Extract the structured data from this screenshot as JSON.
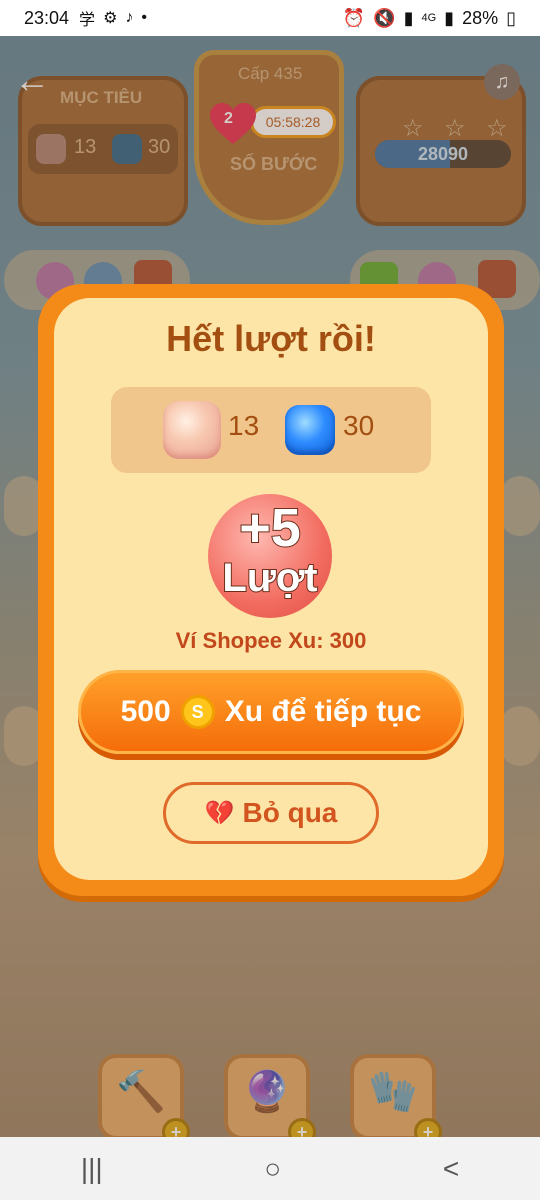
{
  "status_bar": {
    "time": "23:04",
    "left_icons": [
      "学",
      "gear-icon",
      "tiktok-icon",
      "•"
    ],
    "network": "4G",
    "battery": "28%"
  },
  "header": {
    "target_title": "MỤC TIÊU",
    "target_pink_count": "13",
    "target_blue_count": "30",
    "level_label": "Cấp 435",
    "moves_label": "SỐ BƯỚC",
    "lives_count": "2",
    "lives_timer": "05:58:28",
    "score": "28090",
    "stars_earned": 0,
    "stars_total": 3
  },
  "modal": {
    "title": "Hết lượt rồi!",
    "goal_pink_count": "13",
    "goal_blue_count": "30",
    "bonus_plus": "+5",
    "bonus_word": "Lượt",
    "wallet_text": "Ví Shopee Xu: 300",
    "continue_amount": "500",
    "continue_coin": "S",
    "continue_text": "Xu để tiếp tục",
    "skip_label": "Bỏ qua"
  },
  "boosters": [
    {
      "name": "hammer",
      "icon": "hammer-icon"
    },
    {
      "name": "magic-hammer",
      "icon": "magic-hammer-icon"
    },
    {
      "name": "glove",
      "icon": "glove-icon"
    }
  ],
  "nav": {
    "recent": "|||",
    "home": "○",
    "back": "<"
  },
  "colors": {
    "modal_border": "#f48b18",
    "modal_bg": "#fde4a7",
    "title": "#a34f12",
    "button": "#f56d0a"
  }
}
